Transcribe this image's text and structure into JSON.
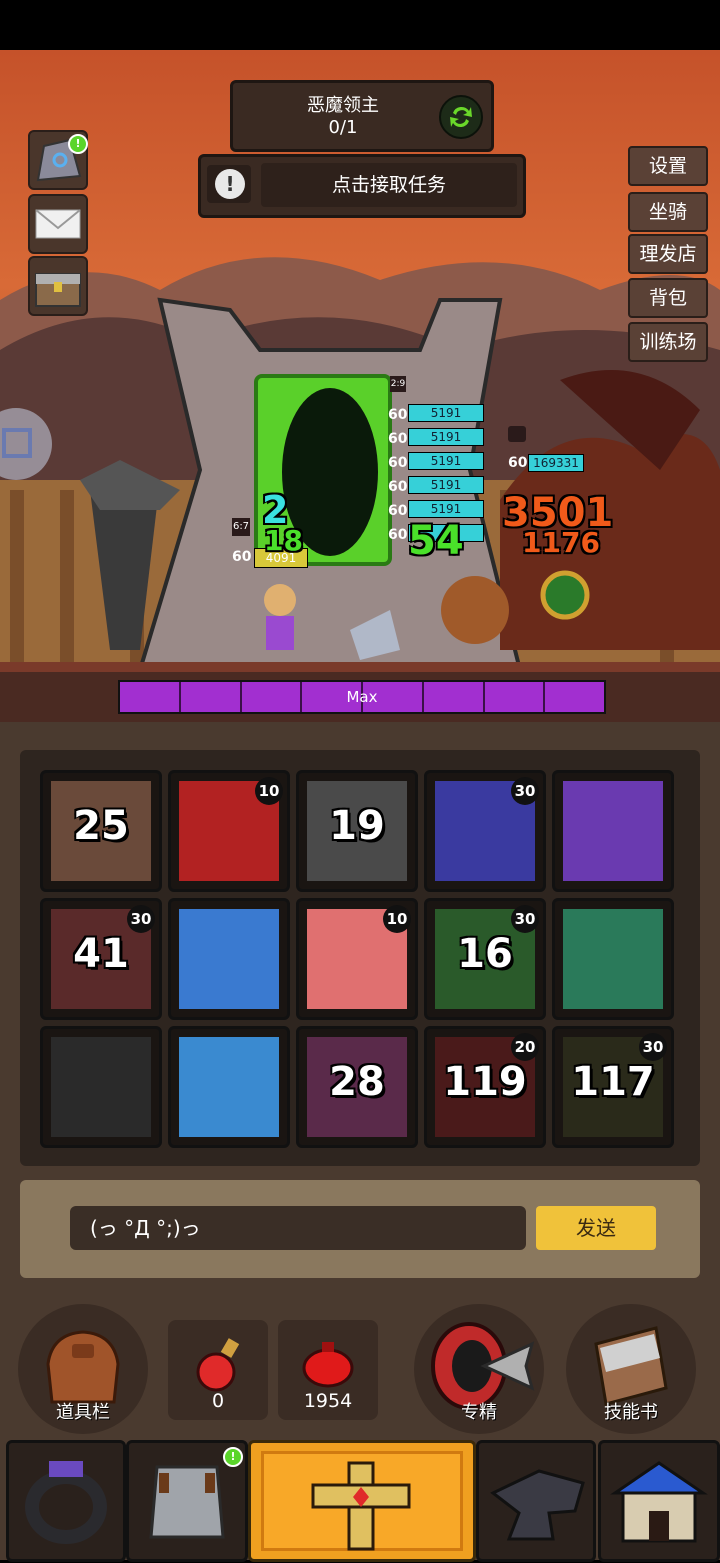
{
  "quest": {
    "title": "恶魔领主",
    "count": "0/1",
    "refresh_icon": "refresh-icon"
  },
  "task": {
    "label": "点击接取任务"
  },
  "right_menu": [
    "设置",
    "坐骑",
    "理发店",
    "背包",
    "训练场"
  ],
  "left_icons": [
    "rune-stone-icon",
    "mail-icon",
    "chest-icon"
  ],
  "battle": {
    "player": {
      "level": "60",
      "hp": "4091",
      "tag": "6:7",
      "dmg_top": "2",
      "dmg_bottom": "18"
    },
    "allies": [
      {
        "level": "60",
        "hp": "5191"
      },
      {
        "level": "60",
        "hp": "5191"
      },
      {
        "level": "60",
        "hp": "5191"
      },
      {
        "level": "60",
        "hp": "5191"
      },
      {
        "level": "60",
        "hp": "5191"
      },
      {
        "level": "60",
        "hp": ""
      }
    ],
    "ally_tag": "2:9",
    "ally_damage": "54",
    "boss": {
      "level": "60",
      "hp": "169331",
      "damage_1": "3501",
      "damage_2": "1176"
    }
  },
  "rage_bar": {
    "label": "Max",
    "segments": 8
  },
  "skills": [
    {
      "num": "25",
      "corner": "",
      "color": "#6a4a3a"
    },
    {
      "num": "",
      "corner": "10",
      "color": "#b22222"
    },
    {
      "num": "19",
      "corner": "",
      "color": "#4a4a4a"
    },
    {
      "num": "",
      "corner": "30",
      "color": "#3a3aa0"
    },
    {
      "num": "",
      "corner": "",
      "color": "#6a3ab0"
    },
    {
      "num": "41",
      "corner": "30",
      "color": "#5a2a2a"
    },
    {
      "num": "",
      "corner": "",
      "color": "#3a7ad0"
    },
    {
      "num": "",
      "corner": "10",
      "color": "#e07070"
    },
    {
      "num": "16",
      "corner": "30",
      "color": "#2a5a2a"
    },
    {
      "num": "",
      "corner": "",
      "color": "#2a7a5a"
    },
    {
      "num": "",
      "corner": "",
      "color": "#2a2a2a"
    },
    {
      "num": "",
      "corner": "",
      "color": "#3a8ad0"
    },
    {
      "num": "28",
      "corner": "",
      "color": "#5a2a4a"
    },
    {
      "num": "119",
      "corner": "20",
      "color": "#4a1a1a"
    },
    {
      "num": "117",
      "corner": "30",
      "color": "#2a2a1a"
    }
  ],
  "chat": {
    "input_value": "(っ °Д °;)っ",
    "send_label": "发送"
  },
  "actions": {
    "items_label": "道具栏",
    "potion_count": "0",
    "elixir_count": "1954",
    "specialize_label": "专精",
    "skillbook_label": "技能书"
  },
  "tabs": [
    "ring-icon",
    "armor-icon",
    "sword-icon",
    "anvil-icon",
    "shop-icon"
  ]
}
